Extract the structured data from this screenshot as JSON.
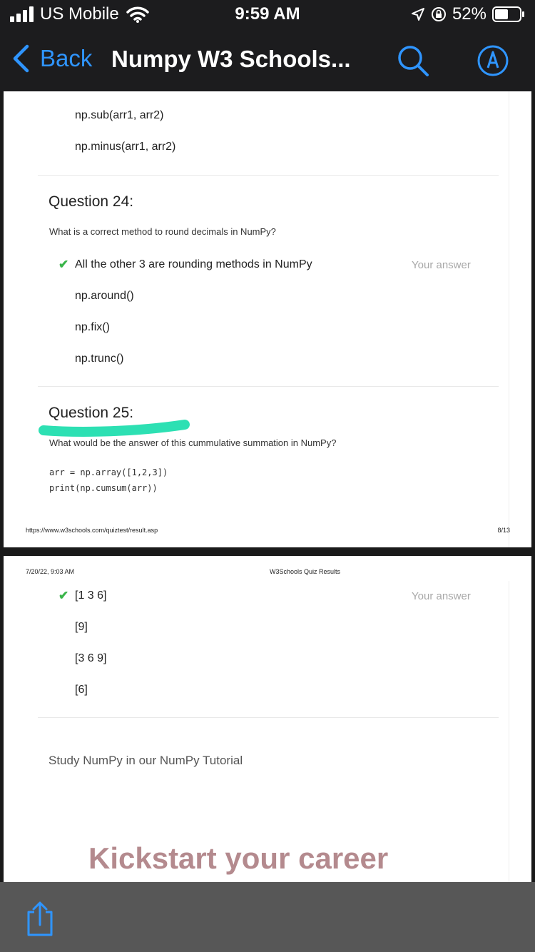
{
  "status_bar": {
    "carrier": "US Mobile",
    "time": "9:59 AM",
    "battery": "52%"
  },
  "nav": {
    "back_label": "Back",
    "title": "Numpy W3 Schools...",
    "accent_color": "#2f95ff"
  },
  "page1": {
    "q23_options": [
      "np.sub(arr1, arr2)",
      "np.minus(arr1, arr2)"
    ],
    "q24": {
      "title": "Question 24:",
      "text": "What is a correct method to round decimals in NumPy?",
      "options": [
        "All the other 3 are rounding methods in NumPy",
        "np.around()",
        "np.fix()",
        "np.trunc()"
      ],
      "your_answer": "Your answer"
    },
    "q25": {
      "title": "Question 25:",
      "text": "What would be the answer of this cummulative summation in NumPy?",
      "code_line1": "arr = np.array([1,2,3])",
      "code_line2": "print(np.cumsum(arr))"
    },
    "footer_url": "https://www.w3schools.com/quiztest/result.asp",
    "footer_page": "8/13"
  },
  "page2": {
    "header_date": "7/20/22, 9:03 AM",
    "header_title": "W3Schools Quiz Results",
    "q25_options": [
      "[1 3 6]",
      "[9]",
      "[3 6 9]",
      "[6]"
    ],
    "your_answer": "Your answer",
    "study_text": "Study NumPy in our NumPy Tutorial",
    "banner_text": "Kickstart your career"
  },
  "colors": {
    "check": "#3ab54a",
    "highlight": "#2de0b3",
    "banner": "#b48a8e"
  }
}
